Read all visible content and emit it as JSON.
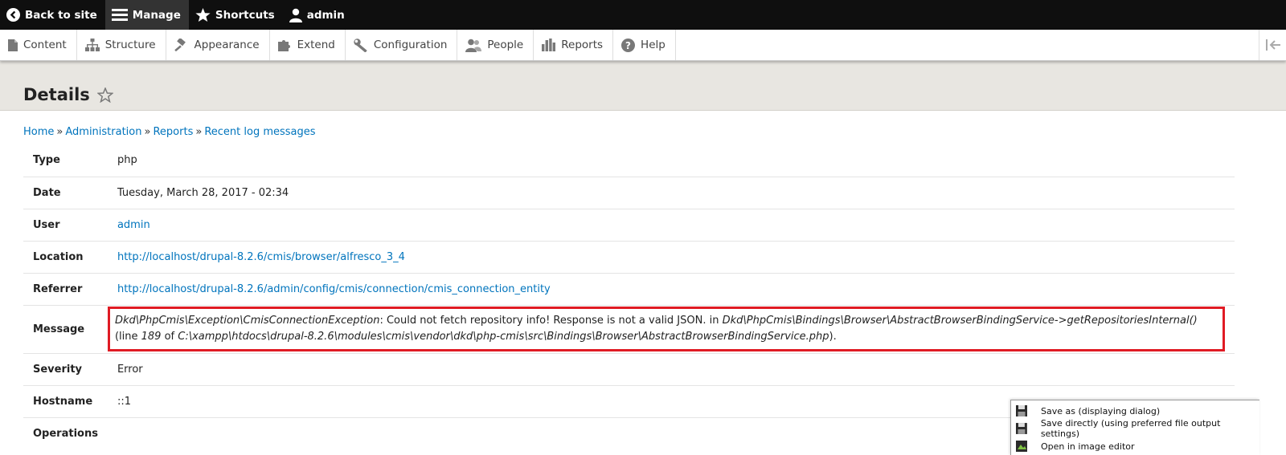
{
  "toolbar": {
    "back_label": "Back to site",
    "manage_label": "Manage",
    "shortcuts_label": "Shortcuts",
    "user_label": "admin"
  },
  "tray": {
    "items": [
      {
        "label": "Content",
        "icon": "file-icon"
      },
      {
        "label": "Structure",
        "icon": "sitemap-icon"
      },
      {
        "label": "Appearance",
        "icon": "paint-icon"
      },
      {
        "label": "Extend",
        "icon": "puzzle-icon"
      },
      {
        "label": "Configuration",
        "icon": "wrench-icon"
      },
      {
        "label": "People",
        "icon": "people-icon"
      },
      {
        "label": "Reports",
        "icon": "bar-chart-icon"
      },
      {
        "label": "Help",
        "icon": "help-icon"
      }
    ]
  },
  "page": {
    "title": "Details"
  },
  "breadcrumb": {
    "home": "Home",
    "administration": "Administration",
    "reports": "Reports",
    "recent_log": "Recent log messages",
    "sep": "»"
  },
  "details": {
    "type_label": "Type",
    "type_value": "php",
    "date_label": "Date",
    "date_value": "Tuesday, March 28, 2017 - 02:34",
    "user_label": "User",
    "user_value": "admin",
    "location_label": "Location",
    "location_value": "http://localhost/drupal-8.2.6/cmis/browser/alfresco_3_4",
    "referrer_label": "Referrer",
    "referrer_value": "http://localhost/drupal-8.2.6/admin/config/cmis/connection/cmis_connection_entity",
    "message_label": "Message",
    "message_exception": "Dkd\\PhpCmis\\Exception\\CmisConnectionException",
    "message_text": ": Could not fetch repository info! Response is not a valid JSON. in ",
    "message_method": "Dkd\\PhpCmis\\Bindings\\Browser\\AbstractBrowserBindingService->getRepositoriesInternal()",
    "message_line_prefix": " (line ",
    "message_line": "189",
    "message_of": " of",
    "message_file": "C:\\xampp\\htdocs\\drupal-8.2.6\\modules\\cmis\\vendor\\dkd\\php-cmis\\src\\Bindings\\Browser\\AbstractBrowserBindingService.php",
    "message_end": ").",
    "severity_label": "Severity",
    "severity_value": "Error",
    "hostname_label": "Hostname",
    "hostname_value": "::1",
    "operations_label": "Operations"
  },
  "popup": {
    "save_as": "Save as (displaying dialog)",
    "save_directly": "Save directly (using preferred file output settings)",
    "open_editor": "Open in image editor"
  },
  "colors": {
    "link": "#0074bd",
    "highlight_border": "#e01b24",
    "toolbar_bg": "#0f0f0f"
  }
}
